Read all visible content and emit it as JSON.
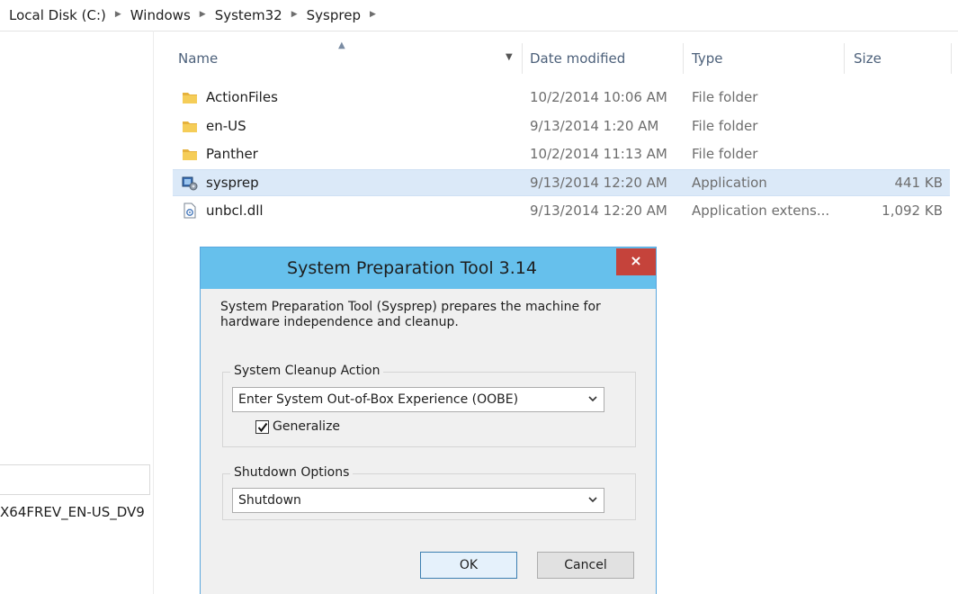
{
  "breadcrumb": [
    "Local Disk (C:)",
    "Windows",
    "System32",
    "Sysprep"
  ],
  "nav": {
    "partial_label": "X64FREV_EN-US_DV9"
  },
  "columns": {
    "name": "Name",
    "date": "Date modified",
    "type": "Type",
    "size": "Size"
  },
  "files": [
    {
      "name": "ActionFiles",
      "date": "10/2/2014 10:06 AM",
      "type": "File folder",
      "size": "",
      "icon": "folder-icon"
    },
    {
      "name": "en-US",
      "date": "9/13/2014 1:20 AM",
      "type": "File folder",
      "size": "",
      "icon": "folder-icon"
    },
    {
      "name": "Panther",
      "date": "10/2/2014 11:13 AM",
      "type": "File folder",
      "size": "",
      "icon": "folder-icon"
    },
    {
      "name": "sysprep",
      "date": "9/13/2014 12:20 AM",
      "type": "Application",
      "size": "441 KB",
      "icon": "application-icon",
      "selected": true
    },
    {
      "name": "unbcl.dll",
      "date": "9/13/2014 12:20 AM",
      "type": "Application extens...",
      "size": "1,092 KB",
      "icon": "dll-file-icon"
    }
  ],
  "dialog": {
    "title": "System Preparation Tool 3.14",
    "close_label": "×",
    "description": "System Preparation Tool (Sysprep) prepares the machine for hardware independence and cleanup.",
    "cleanup_group_title": "System Cleanup Action",
    "cleanup_value": "Enter System Out-of-Box Experience (OOBE)",
    "generalize_label": "Generalize",
    "generalize_checked": true,
    "shutdown_group_title": "Shutdown Options",
    "shutdown_value": "Shutdown",
    "ok_label": "OK",
    "cancel_label": "Cancel"
  },
  "colors": {
    "title_bar": "#66c0ec",
    "close_button": "#c5433b",
    "selection": "#dbe9f8"
  }
}
